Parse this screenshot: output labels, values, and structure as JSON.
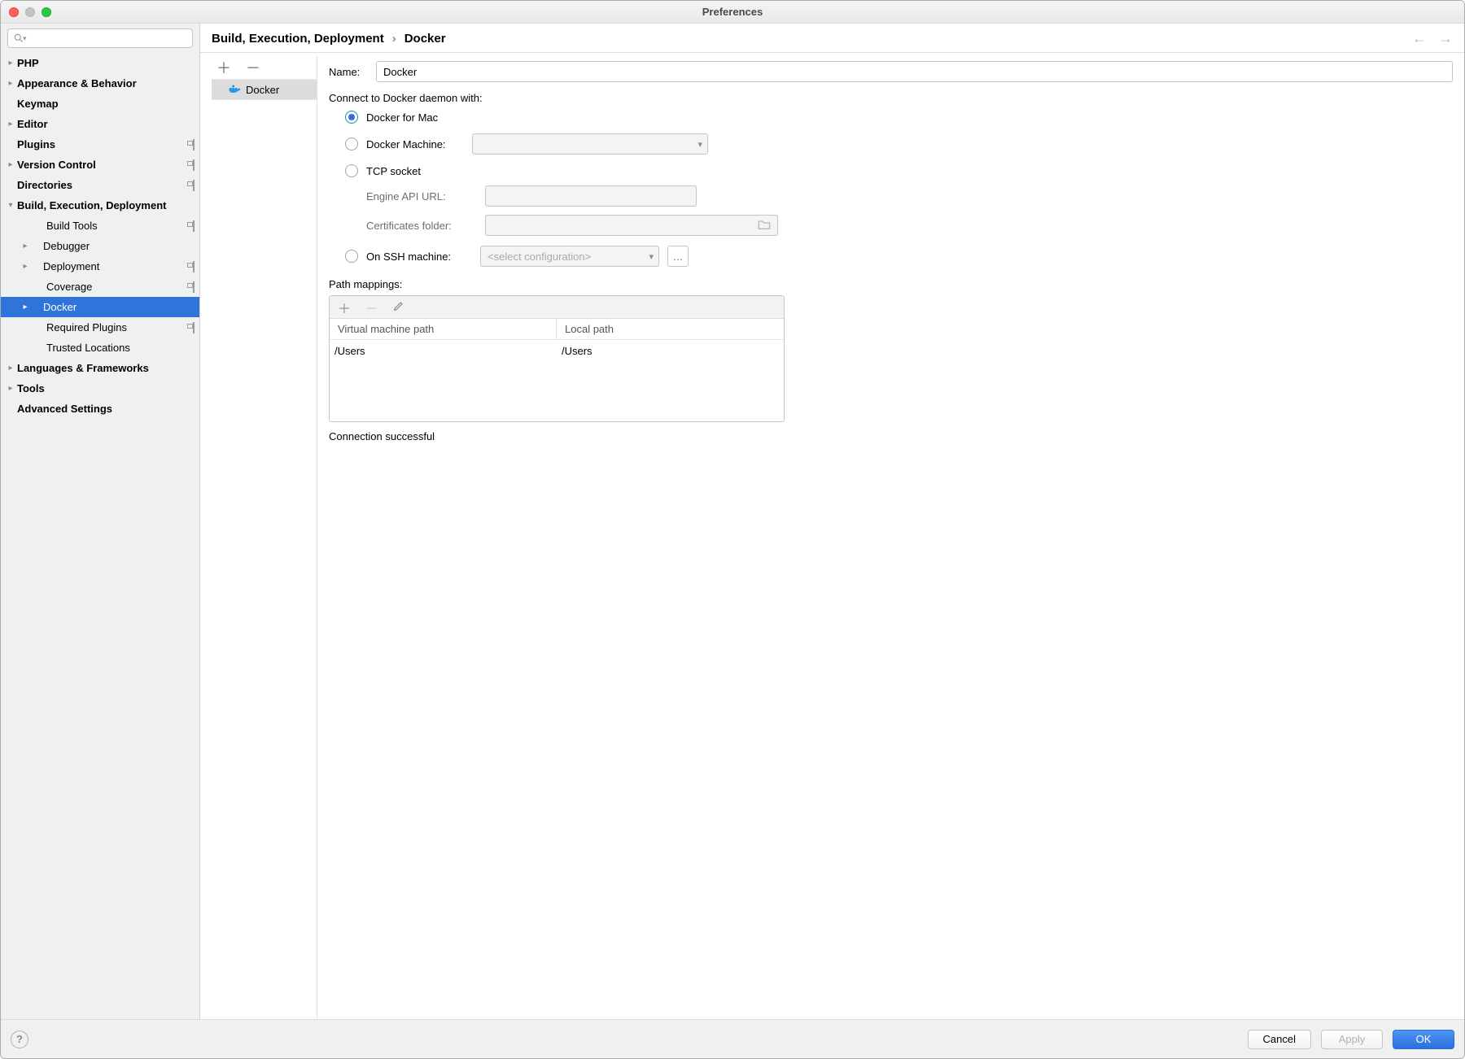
{
  "window": {
    "title": "Preferences"
  },
  "sidebar": {
    "search_placeholder": "",
    "items": [
      {
        "label": "PHP",
        "expandable": true,
        "level": 0
      },
      {
        "label": "Appearance & Behavior",
        "expandable": true,
        "level": 0
      },
      {
        "label": "Keymap",
        "expandable": false,
        "level": 0
      },
      {
        "label": "Editor",
        "expandable": true,
        "level": 0
      },
      {
        "label": "Plugins",
        "expandable": false,
        "level": 0,
        "trail": true
      },
      {
        "label": "Version Control",
        "expandable": true,
        "level": 0,
        "trail": true
      },
      {
        "label": "Directories",
        "expandable": false,
        "level": 0,
        "trail": true
      },
      {
        "label": "Build, Execution, Deployment",
        "expandable": true,
        "level": 0,
        "open": true
      },
      {
        "label": "Build Tools",
        "expandable": false,
        "level": 1,
        "trail": true
      },
      {
        "label": "Debugger",
        "expandable": true,
        "level": 1
      },
      {
        "label": "Deployment",
        "expandable": true,
        "level": 1,
        "trail": true
      },
      {
        "label": "Coverage",
        "expandable": false,
        "level": 1,
        "trail": true
      },
      {
        "label": "Docker",
        "expandable": true,
        "level": 1,
        "selected": true
      },
      {
        "label": "Required Plugins",
        "expandable": false,
        "level": 1,
        "trail": true
      },
      {
        "label": "Trusted Locations",
        "expandable": false,
        "level": 1
      },
      {
        "label": "Languages & Frameworks",
        "expandable": true,
        "level": 0
      },
      {
        "label": "Tools",
        "expandable": true,
        "level": 0
      },
      {
        "label": "Advanced Settings",
        "expandable": false,
        "level": 0
      }
    ]
  },
  "breadcrumb": {
    "parent": "Build, Execution, Deployment",
    "current": "Docker"
  },
  "serverList": {
    "selected": "Docker"
  },
  "form": {
    "name_label": "Name:",
    "name_value": "Docker",
    "connect_label": "Connect to Docker daemon with:",
    "opt_mac": "Docker for Mac",
    "opt_machine": "Docker Machine:",
    "opt_tcp": "TCP socket",
    "engine_url_label": "Engine API URL:",
    "certs_label": "Certificates folder:",
    "opt_ssh": "On SSH machine:",
    "ssh_placeholder": "<select configuration>",
    "path_label": "Path mappings:",
    "col_vm": "Virtual machine path",
    "col_local": "Local path",
    "row_vm": "/Users",
    "row_local": "/Users",
    "status": "Connection successful"
  },
  "footer": {
    "cancel": "Cancel",
    "apply": "Apply",
    "ok": "OK"
  }
}
